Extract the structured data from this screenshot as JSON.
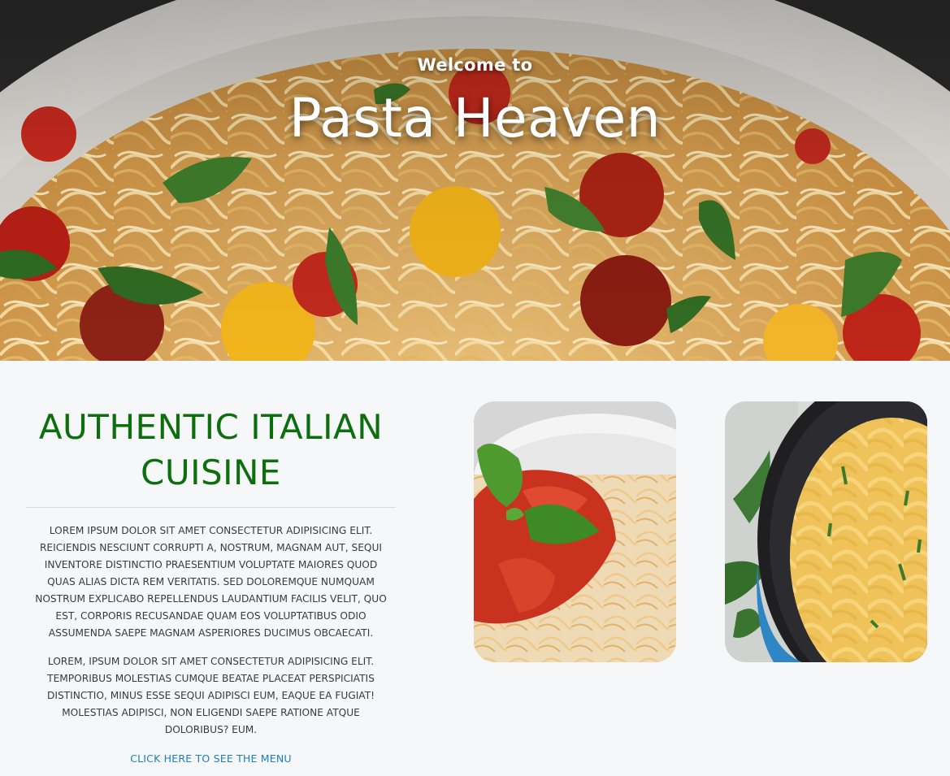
{
  "hero": {
    "subtitle": "Welcome to",
    "title": "Pasta Heaven",
    "image": "spaghetti-with-tomatoes-and-basil-photo"
  },
  "intro": {
    "heading": "AUTHENTIC ITALIAN CUISINE",
    "paragraphs": [
      "Lorem ipsum dolor sit amet consectetur adipisicing elit. Reiciendis nesciunt corrupti a, nostrum, magnam aut, sequi inventore distinctio praesentium voluptate maiores quod quas alias dicta rem veritatis. Sed doloremque numquam nostrum explicabo repellendus laudantium facilis velit, quo est, corporis recusandae quam eos voluptatibus odio assumenda saepe magnam asperiores ducimus obcaecati.",
      "Lorem, ipsum dolor sit amet consectetur adipisicing elit. Temporibus molestias cumque beatae placeat perspiciatis distinctio, minus esse sequi adipisci eum, eaque ea fugiat! Molestias adipisci, non eligendi saepe ratione atque doloribus? Eum."
    ],
    "menu_link": "CLICK HERE TO SEE THE MENU"
  },
  "gallery": [
    {
      "image": "spaghetti-with-tomato-sauce-and-basil-photo"
    },
    {
      "image": "tagliatelle-in-cast-iron-pan-photo"
    }
  ],
  "colors": {
    "heading_green": "#0d6e0d",
    "link_blue": "#1a7fc1",
    "page_background": "#f6f7f9",
    "hero_text": "#ffffff"
  }
}
